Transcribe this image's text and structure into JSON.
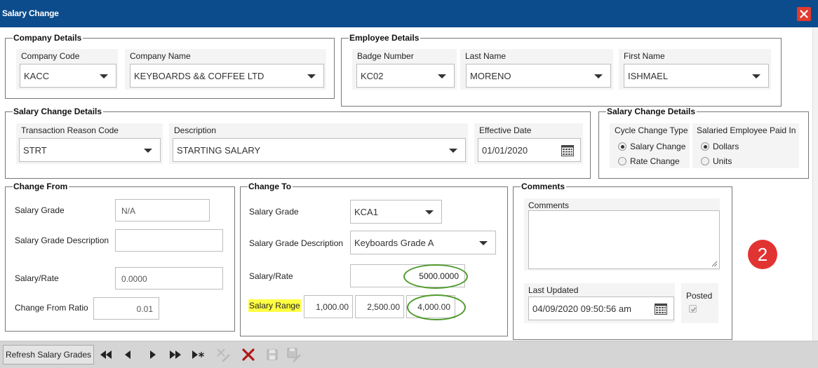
{
  "window": {
    "title": "Salary Change",
    "close_icon": "close-icon"
  },
  "company_details": {
    "legend": "Company Details",
    "company_code": {
      "label": "Company Code",
      "value": "KACC"
    },
    "company_name": {
      "label": "Company Name",
      "value": "KEYBOARDS && COFFEE LTD"
    }
  },
  "employee_details": {
    "legend": "Employee Details",
    "badge_number": {
      "label": "Badge Number",
      "value": "KC02"
    },
    "last_name": {
      "label": "Last Name",
      "value": "MORENO"
    },
    "first_name": {
      "label": "First Name",
      "value": "ISHMAEL"
    }
  },
  "salary_change_details": {
    "legend": "Salary Change Details",
    "transaction_reason_code": {
      "label": "Transaction Reason Code",
      "value": "STRT"
    },
    "description": {
      "label": "Description",
      "value": "STARTING SALARY"
    },
    "effective_date": {
      "label": "Effective Date",
      "value": "01/01/2020"
    }
  },
  "salary_change_options": {
    "legend": "Salary Change Details",
    "cycle_change_type": {
      "label": "Cycle Change Type",
      "options": [
        "Salary Change",
        "Rate Change"
      ],
      "selected": "Salary Change"
    },
    "paid_in": {
      "label": "Salaried Employee Paid In",
      "options": [
        "Dollars",
        "Units"
      ],
      "selected": "Dollars"
    }
  },
  "change_from": {
    "legend": "Change From",
    "salary_grade": {
      "label": "Salary Grade",
      "value": "N/A"
    },
    "salary_grade_description": {
      "label": "Salary Grade Description",
      "value": ""
    },
    "salary_rate": {
      "label": "Salary/Rate",
      "value": "0.0000"
    },
    "change_from_ratio": {
      "label": "Change From Ratio",
      "value": "0.01"
    }
  },
  "change_to": {
    "legend": "Change To",
    "salary_grade": {
      "label": "Salary Grade",
      "value": "KCA1"
    },
    "salary_grade_description": {
      "label": "Salary Grade Description",
      "value": "Keyboards Grade A"
    },
    "salary_rate": {
      "label": "Salary/Rate",
      "value": "5000.0000"
    },
    "salary_range": {
      "label": "Salary Range",
      "min": "1,000.00",
      "mid": "2,500.00",
      "max": "4,000.00"
    }
  },
  "comments": {
    "legend": "Comments",
    "comments_label": "Comments",
    "comments_value": "",
    "last_updated": {
      "label": "Last Updated",
      "value": "04/09/2020 09:50:56 am"
    },
    "posted": {
      "label": "Posted",
      "checked": true
    }
  },
  "annotation_badge": "2",
  "toolbar": {
    "refresh_label": "Refresh Salary Grades",
    "buttons": [
      "first-record-icon",
      "previous-record-icon",
      "next-record-icon",
      "last-record-icon",
      "new-record-icon",
      "edit-icon",
      "delete-icon",
      "save-icon",
      "save-edit-icon"
    ]
  },
  "colors": {
    "titlebar": "#0d4c8c",
    "close": "#e23a2e",
    "highlight": "#ffff44",
    "oval": "#4f9a2c",
    "badge": "#e23333"
  }
}
